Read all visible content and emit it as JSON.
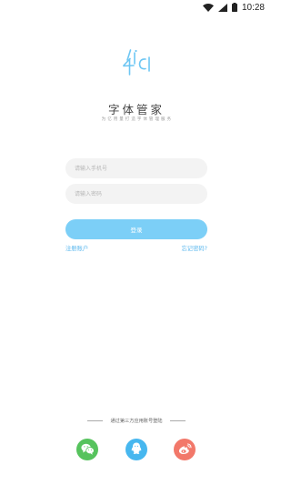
{
  "status_bar": {
    "time": "10:28"
  },
  "app": {
    "name": "字体管家",
    "slogan": "为 亿 用 量 打 造 字 体 管 理 服 务",
    "logo_icon": "app-logo-icon"
  },
  "form": {
    "phone_placeholder": "请输入手机号",
    "password_placeholder": "请输入密码",
    "login_label": "登录"
  },
  "links": {
    "register": "注册账户",
    "forgot_password": "忘记密码?"
  },
  "social": {
    "divider_text": "通过第三方应用账号登陆",
    "items": [
      {
        "name": "wechat",
        "icon": "wechat-icon",
        "color": "#56c35d"
      },
      {
        "name": "qq",
        "icon": "qq-icon",
        "color": "#47b7ef"
      },
      {
        "name": "weibo",
        "icon": "weibo-icon",
        "color": "#f2786a"
      }
    ]
  },
  "colors": {
    "accent": "#7ccff7",
    "link": "#5ab7ee",
    "field_bg": "#f3f3f3"
  }
}
